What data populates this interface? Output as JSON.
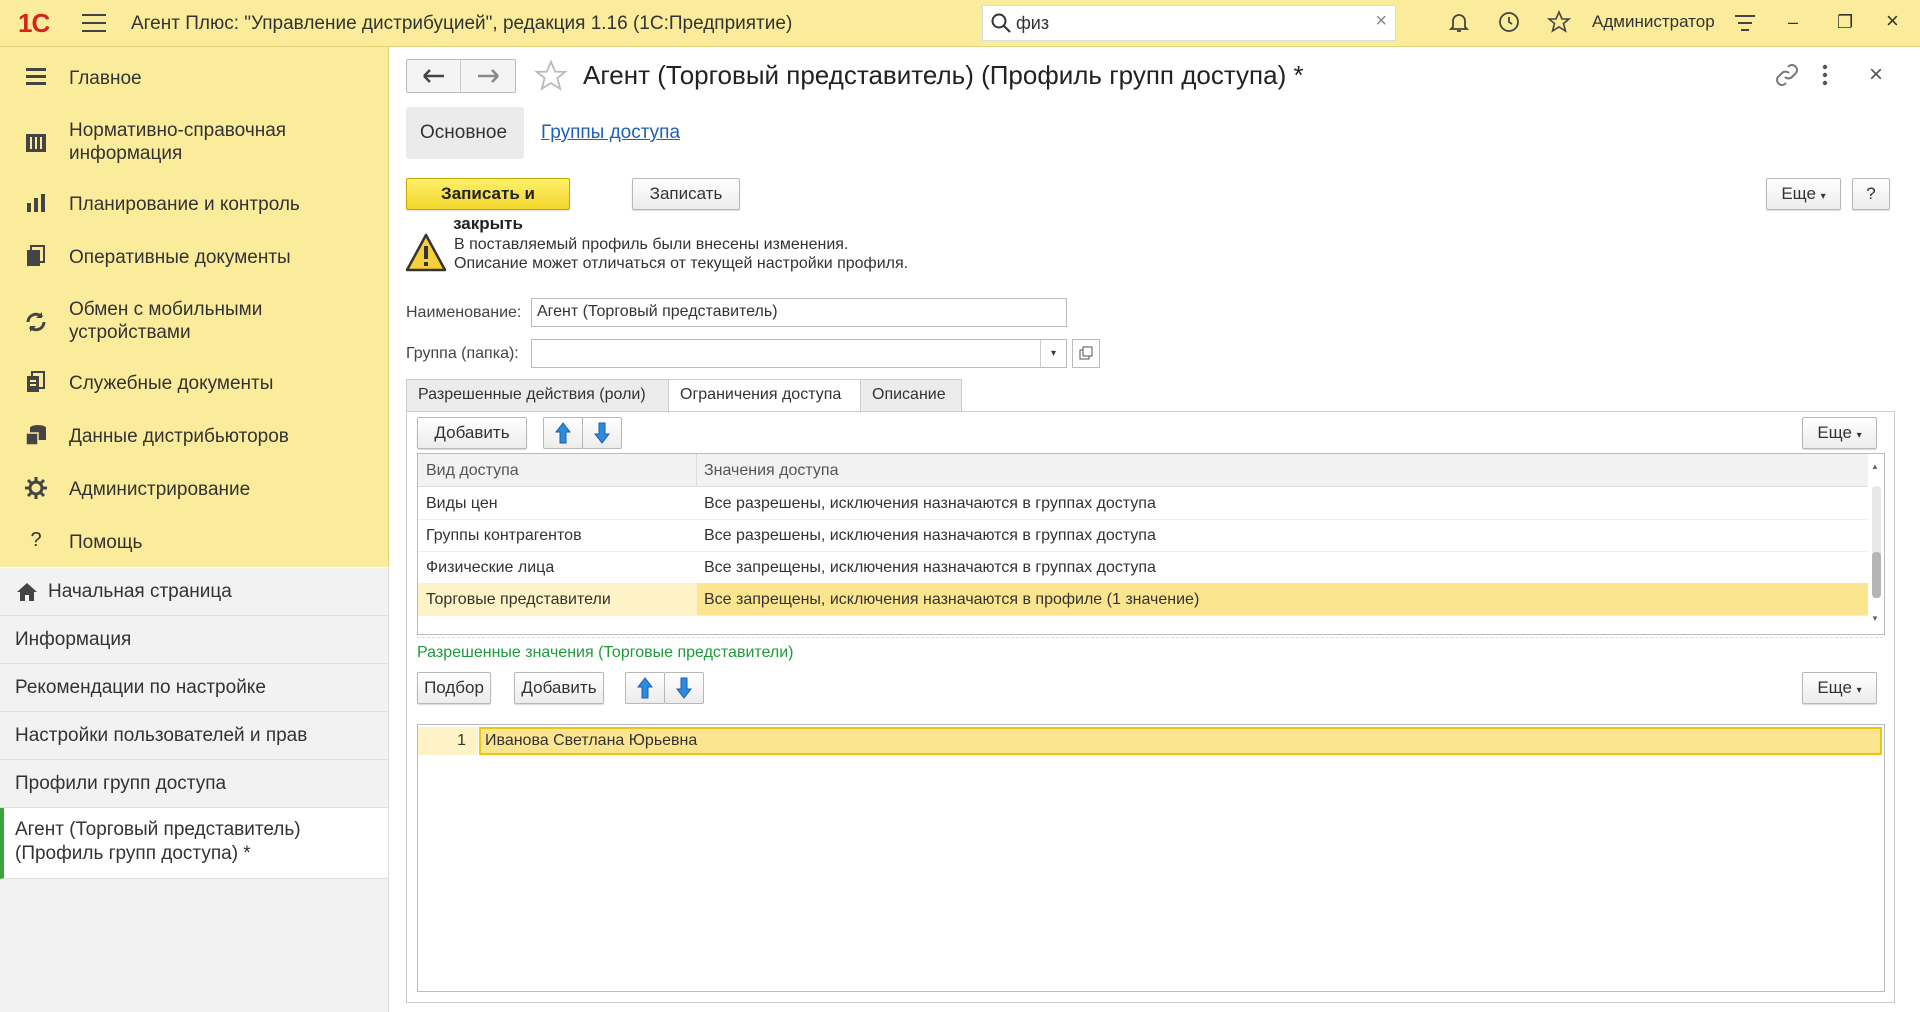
{
  "topbar": {
    "logo": "1С",
    "title": "Агент Плюс: \"Управление дистрибуцией\", редакция 1.16  (1С:Предприятие)",
    "search_value": "физ",
    "user": "Администратор",
    "icons": [
      "menu-icon",
      "search-icon",
      "clear-icon",
      "bell-icon",
      "history-icon",
      "star-icon",
      "settings-icon",
      "minimize-icon",
      "restore-icon",
      "close-icon"
    ]
  },
  "sidebar": {
    "sections": [
      {
        "label": "Главное",
        "icon": "menu-icon"
      },
      {
        "label": "Нормативно-справочная информация",
        "icon": "reference-icon"
      },
      {
        "label": "Планирование и контроль",
        "icon": "chart-icon"
      },
      {
        "label": "Оперативные документы",
        "icon": "documents-icon"
      },
      {
        "label": "Обмен с мобильными устройствами",
        "icon": "sync-icon"
      },
      {
        "label": "Служебные документы",
        "icon": "service-docs-icon"
      },
      {
        "label": "Данные дистрибьюторов",
        "icon": "distributors-icon"
      },
      {
        "label": "Администрирование",
        "icon": "gear-icon"
      },
      {
        "label": "Помощь",
        "icon": "help-icon"
      }
    ]
  },
  "navpanel": {
    "items": [
      {
        "label": "Начальная страница",
        "icon": "home-icon"
      },
      {
        "label": "Информация"
      },
      {
        "label": "Рекомендации по настройке"
      },
      {
        "label": "Настройки пользователей и прав"
      },
      {
        "label": "Профили групп доступа"
      },
      {
        "label": "Агент (Торговый представитель) (Профиль групп доступа) *",
        "active": true
      }
    ]
  },
  "form": {
    "title": "Агент (Торговый представитель) (Профиль групп доступа) *",
    "tabs": {
      "main": "Основное",
      "link": "Группы доступа"
    },
    "buttons": {
      "save_close": "Записать и закрыть",
      "save": "Записать",
      "more": "Еще",
      "help": "?"
    },
    "warning": {
      "line1": "В поставляемый профиль были внесены изменения.",
      "line2": "Описание может отличаться от текущей настройки профиля."
    },
    "name_label": "Наименование:",
    "name_value": "Агент (Торговый представитель)",
    "group_label": "Группа (папка):",
    "group_value": "",
    "inner_tabs": [
      "Разрешенные действия (роли)",
      "Ограничения доступа",
      "Описание"
    ],
    "active_inner_tab": 1,
    "access": {
      "add_label": "Добавить",
      "more_label": "Еще",
      "columns": [
        "Вид доступа",
        "Значения доступа"
      ],
      "rows": [
        {
          "kind": "Виды цен",
          "value": "Все разрешены, исключения назначаются в группах доступа"
        },
        {
          "kind": "Группы контрагентов",
          "value": "Все разрешены, исключения назначаются в группах доступа"
        },
        {
          "kind": "Физические лица",
          "value": "Все запрещены, исключения назначаются в группах доступа"
        },
        {
          "kind": "Торговые представители",
          "value": "Все запрещены, исключения назначаются в профиле (1 значение)",
          "selected": true
        }
      ]
    },
    "allowed": {
      "label": "Разрешенные значения (Торговые представители)",
      "pick_label": "Подбор",
      "add_label": "Добавить",
      "more_label": "Еще",
      "rows": [
        {
          "num": "1",
          "value": "Иванова Светлана Юрьевна"
        }
      ]
    }
  },
  "colors": {
    "accent_yellow": "#fbec9b",
    "primary_button": "#f3d62d",
    "selection": "#fbe58f",
    "green_label": "#1d9b3a",
    "link": "#1f5fb8",
    "logo_red": "#d8231b"
  }
}
